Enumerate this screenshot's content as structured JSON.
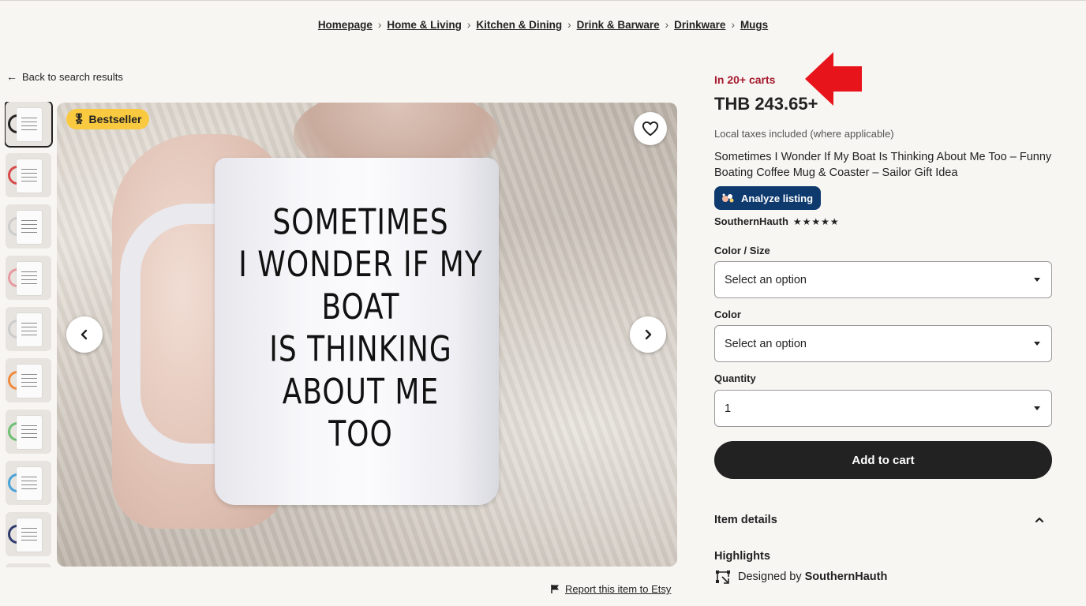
{
  "breadcrumb": {
    "items": [
      "Homepage",
      "Home & Living",
      "Kitchen & Dining",
      "Drink & Barware",
      "Drinkware",
      "Mugs"
    ],
    "separator": "›"
  },
  "back_link": "Back to search results",
  "gallery": {
    "badge": "Bestseller",
    "mug_text": [
      "SOMETIMES",
      "I WONDER IF MY",
      "BOAT",
      "IS THINKING",
      "ABOUT ME",
      "TOO"
    ],
    "thumbnail_accent_colors": [
      "#222222",
      "#d84a4a",
      "#cccccc",
      "#e89aa0",
      "#cccccc",
      "#f08a3c",
      "#6fbf73",
      "#4aa3d8",
      "#2e3a6e",
      "#555555"
    ]
  },
  "report_link": "Report this item to Etsy",
  "listing": {
    "carts": "In 20+ carts",
    "price": "THB 243.65+",
    "taxes_note": "Local taxes included (where applicable)",
    "title": "Sometimes I Wonder If My Boat Is Thinking About Me Too – Funny Boating Coffee Mug & Coaster – Sailor Gift Idea",
    "analyze_button": "Analyze listing",
    "seller_name": "SouthernHauth",
    "seller_stars": "★★★★★"
  },
  "options": {
    "color_size_label": "Color / Size",
    "color_size_value": "Select an option",
    "color_label": "Color",
    "color_value": "Select an option",
    "quantity_label": "Quantity",
    "quantity_value": "1"
  },
  "add_to_cart": "Add to cart",
  "details": {
    "item_details": "Item details",
    "highlights": "Highlights",
    "designed_by_prefix": "Designed by",
    "designed_by_name": "SouthernHauth"
  },
  "colors": {
    "accent_red": "#a61a2e",
    "analyze_blue": "#0e3a6e",
    "badge_yellow": "#f9c940",
    "annotation_arrow": "#e8141b"
  }
}
